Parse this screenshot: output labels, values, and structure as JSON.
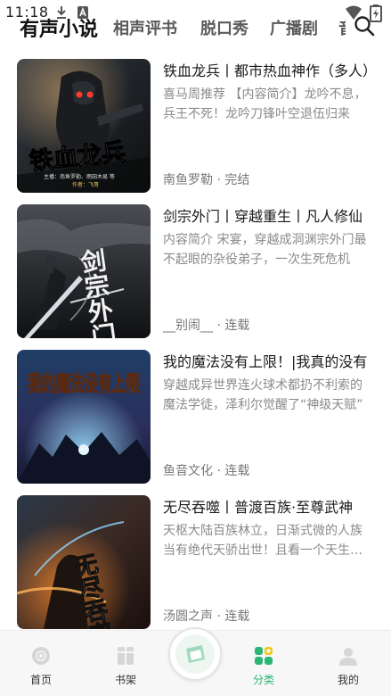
{
  "status_bar": {
    "time": "11:18",
    "icons": [
      "download-icon",
      "notification-a-icon",
      "wifi-icon",
      "battery-icon"
    ]
  },
  "top_tabs": [
    {
      "label": "有声小说",
      "active": true
    },
    {
      "label": "相声评书",
      "active": false
    },
    {
      "label": "脱口秀",
      "active": false
    },
    {
      "label": "广播剧",
      "active": false
    },
    {
      "label": "音",
      "active": false
    }
  ],
  "books": [
    {
      "title": "铁血龙兵丨都市热血神作（多人）",
      "description": "喜马周推荐 【内容简介】龙吟不息，兵王不死！龙吟刀锋叶空退伍归来",
      "meta": "南鱼罗勒 · 完结",
      "cover": {
        "title_text": "铁血龙兵",
        "sub_text": "主播：南鱼罗勒、雨田木易 等",
        "author_text": "作者：飞哥"
      }
    },
    {
      "title": "剑宗外门丨穿越重生丨凡人修仙",
      "description": "内容简介 宋宴，穿越成洞渊宗外门最不起眼的杂役弟子，一次生死危机",
      "meta": "__别闹__ · 连载",
      "cover": {
        "title_text": "剑宗外门"
      }
    },
    {
      "title": "我的魔法没有上限！|我真的没有",
      "description": "穿越成异世界连火球术都扔不利索的魔法学徒，泽利尔觉醒了“神级天赋”",
      "meta": "鱼音文化 · 连载",
      "cover": {
        "title_text": "我的魔法没有上限"
      }
    },
    {
      "title": "无尽吞噬丨普渡百族·至尊武神",
      "description": "天枢大陆百族林立，日渐式微的人族当有绝代天骄出世！且看一个天生废体",
      "meta": "汤圆之声 · 连载",
      "cover": {
        "title_text": "无尽吞噬"
      }
    }
  ],
  "bottom_nav": {
    "items": [
      {
        "label": "首页",
        "icon": "home-disc-icon",
        "active": false
      },
      {
        "label": "书架",
        "icon": "bookshelf-icon",
        "active": false
      },
      {
        "label": "",
        "icon": "play-fab-icon",
        "active": false
      },
      {
        "label": "分类",
        "icon": "category-icon",
        "active": true
      },
      {
        "label": "我的",
        "icon": "profile-icon",
        "active": false
      }
    ]
  },
  "colors": {
    "accent": "#2bb673",
    "text_primary": "#1a1a1a",
    "text_secondary": "#8a8a8a",
    "nav_background": "#f7f7f7"
  }
}
